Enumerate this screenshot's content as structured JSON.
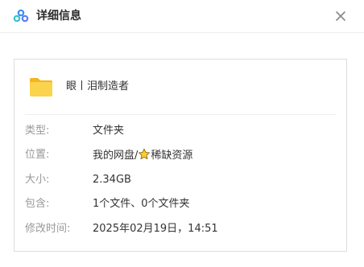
{
  "header": {
    "title": "详细信息",
    "logo_icon": "cloud-logo-icon",
    "close_icon": "close-icon"
  },
  "file": {
    "icon": "folder-icon",
    "name": "眼丨泪制造者"
  },
  "details": [
    {
      "label": "类型:",
      "value": "文件夹"
    },
    {
      "label": "位置:",
      "value_prefix": "我的网盘/",
      "value_icon": "star-icon",
      "value_suffix": "稀缺资源"
    },
    {
      "label": "大小:",
      "value": "2.34GB"
    },
    {
      "label": "包含:",
      "value": "1个文件、0个文件夹"
    },
    {
      "label": "修改时间:",
      "value": "2025年02月19日，14:51"
    }
  ],
  "colors": {
    "folder": "#f9c941",
    "label": "#999999",
    "text": "#333333",
    "accent_blue": "#3a8ef6",
    "accent_teal": "#35c4c9"
  }
}
